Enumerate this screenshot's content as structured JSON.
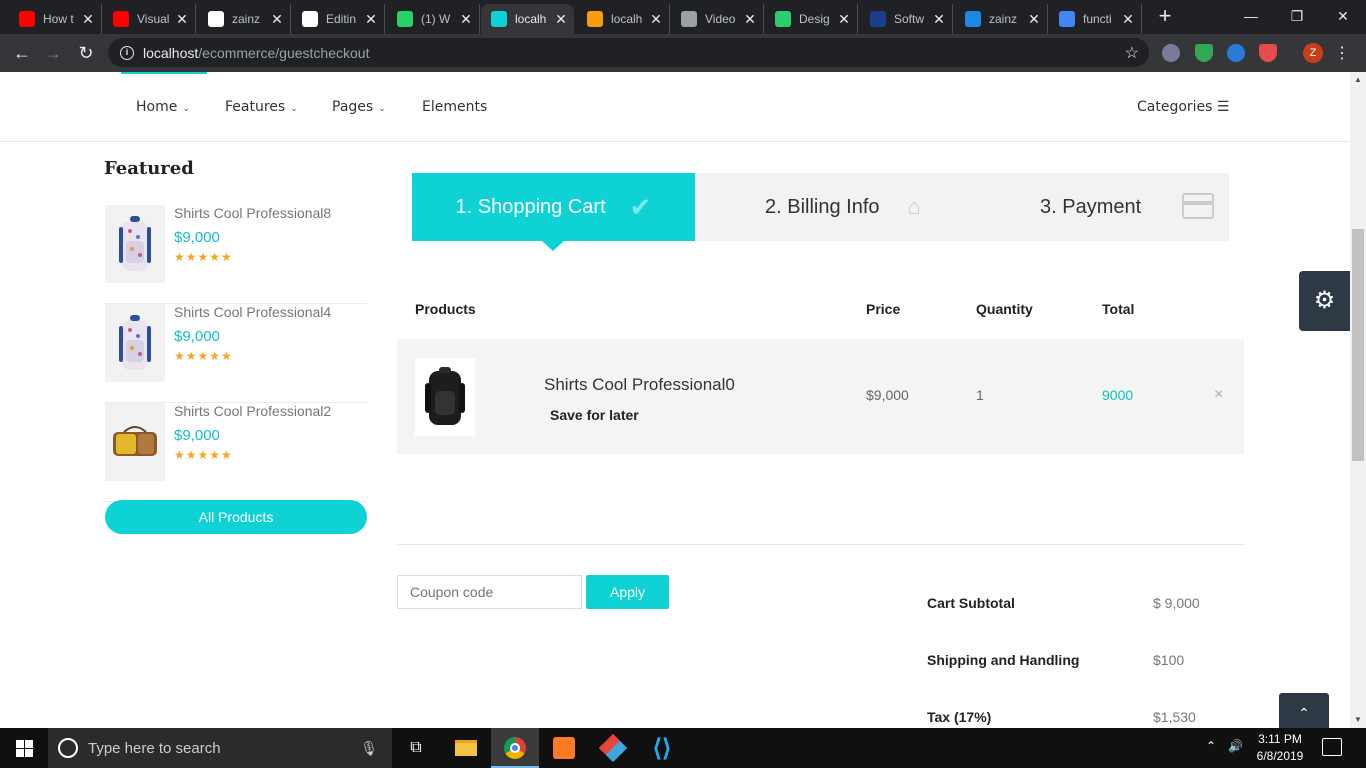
{
  "browser": {
    "tabs": [
      {
        "label": "How t",
        "icon": "youtube-icon",
        "color": "#ff0000"
      },
      {
        "label": "Visual",
        "icon": "youtube-icon",
        "color": "#ff0000"
      },
      {
        "label": "zainz",
        "icon": "github-icon",
        "color": "#ffffff"
      },
      {
        "label": "Editin",
        "icon": "github-icon",
        "color": "#ffffff"
      },
      {
        "label": "(1) W",
        "icon": "whatsapp-icon",
        "color": "#25d366"
      },
      {
        "label": "localh",
        "icon": "lock-icon",
        "color": "#0fd2d5"
      },
      {
        "label": "localh",
        "icon": "phpmyadmin-icon",
        "color": "#f89c0e"
      },
      {
        "label": "Video",
        "icon": "globe-icon",
        "color": "#9aa0a6"
      },
      {
        "label": "Desig",
        "icon": "design-icon",
        "color": "#2ecc71"
      },
      {
        "label": "Softw",
        "icon": "software-icon",
        "color": "#1a3f8f"
      },
      {
        "label": "zainz",
        "icon": "fn-icon",
        "color": "#1e88e5"
      },
      {
        "label": "functi",
        "icon": "google-icon",
        "color": "#4285f4"
      }
    ],
    "url_host": "localhost",
    "url_path": "/ecommerce/guestcheckout",
    "profile_initial": "Z"
  },
  "nav": {
    "home": "Home",
    "features": "Features",
    "pages": "Pages",
    "elements": "Elements",
    "categories": "Categories"
  },
  "sidebar": {
    "title": "Featured",
    "items": [
      {
        "name": "Shirts Cool Professional8",
        "price": "$9,000",
        "stars": "★★★★★",
        "thumb": "backpack"
      },
      {
        "name": "Shirts Cool Professional4",
        "price": "$9,000",
        "stars": "★★★★★",
        "thumb": "backpack"
      },
      {
        "name": "Shirts Cool Professional2",
        "price": "$9,000",
        "stars": "★★★★★",
        "thumb": "bag"
      }
    ],
    "all_products": "All Products"
  },
  "steps": {
    "step1": "1. Shopping Cart",
    "step2": "2. Billing Info",
    "step3": "3. Payment"
  },
  "table": {
    "headers": {
      "products": "Products",
      "price": "Price",
      "quantity": "Quantity",
      "total": "Total"
    },
    "row": {
      "name": "Shirts Cool Professional0",
      "save": "Save for later",
      "price": "$9,000",
      "quantity": "1",
      "total": "9000",
      "remove": "×"
    }
  },
  "coupon": {
    "placeholder": "Coupon code",
    "apply": "Apply"
  },
  "summary": [
    {
      "label": "Cart Subtotal",
      "value": "$ 9,000"
    },
    {
      "label": "Shipping and Handling",
      "value": "$100"
    },
    {
      "label": "Tax (17%)",
      "value": "$1,530"
    }
  ],
  "taskbar": {
    "search_placeholder": "Type here to search",
    "time": "3:11 PM",
    "date": "6/8/2019"
  },
  "colors": {
    "accent": "#0fd2d5",
    "dark": "#2d3945"
  }
}
